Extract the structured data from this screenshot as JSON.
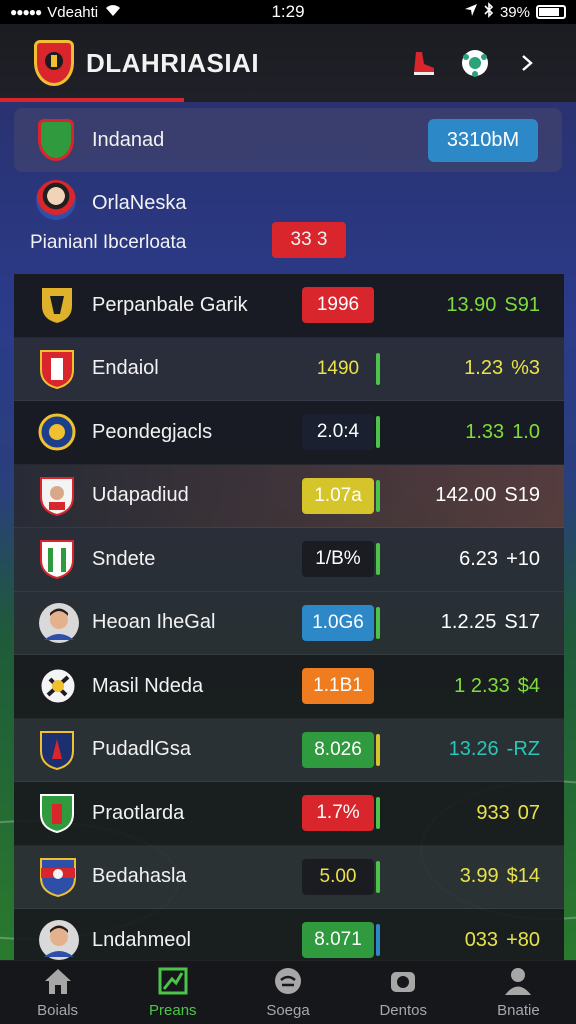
{
  "status_bar": {
    "carrier": "Vdeahti",
    "time": "1:29",
    "battery": "39%"
  },
  "header": {
    "title": "DLAHRIASIAI"
  },
  "top_row": {
    "name": "Indanad",
    "value": "3310bM"
  },
  "group": {
    "name": "OrlaNeska",
    "subtitle": "Pianianl Ibcerloata",
    "value": "33 3"
  },
  "rows": [
    {
      "name": "Perpanbale Garik",
      "odds": "1996",
      "odds_bg": "#d9252c",
      "odds_color": "#ffffff",
      "bar": "",
      "right_a": "13.90",
      "right_b": "S91",
      "right_color": "#7fdc3a",
      "style": "dark",
      "icon": "crest-yellow-icon"
    },
    {
      "name": "Endaiol",
      "odds": "1490",
      "odds_bg": "transparent",
      "odds_color": "#e8e24a",
      "bar": "#4cc44a",
      "right_a": "1.23",
      "right_b": "%3",
      "right_color": "#e8e24a",
      "style": "mid",
      "icon": "crest-red-icon"
    },
    {
      "name": "Peondegjacls",
      "odds": "2.0:4",
      "odds_bg": "#1b2030",
      "odds_color": "#ffffff",
      "bar": "#4cc44a",
      "right_a": "1.33",
      "right_b": "1.0",
      "right_color": "#7fdc3a",
      "style": "dark",
      "icon": "crest-blue-yellow-icon"
    },
    {
      "name": "Udapadiud",
      "odds": "1.07a",
      "odds_bg": "#d6c52a",
      "odds_color": "#ffffff",
      "bar": "#4cc44a",
      "right_a": "142.00",
      "right_b": "S19",
      "right_color": "#ffffff",
      "style": "hl",
      "icon": "avatar-icon"
    },
    {
      "name": "Sndete",
      "odds": "1/B%",
      "odds_bg": "#1b1c22",
      "odds_color": "#ffffff",
      "bar": "#4cc44a",
      "right_a": "6.23",
      "right_b": "+10",
      "right_color": "#ffffff",
      "style": "mid",
      "icon": "crest-green-icon"
    },
    {
      "name": "Heoan IheGal",
      "odds": "1.0G6",
      "odds_bg": "#2d88c8",
      "odds_color": "#ffffff",
      "bar": "#4cc44a",
      "right_a": "1.2.25",
      "right_b": "S17",
      "right_color": "#ffffff",
      "style": "mid",
      "icon": "player-photo-icon"
    },
    {
      "name": "Masil Ndeda",
      "odds": "1.1B1",
      "odds_bg": "#ef7d20",
      "odds_color": "#ffffff",
      "bar": "",
      "right_a": "1 2.33",
      "right_b": "$4",
      "right_color": "#7fdc3a",
      "style": "dark",
      "icon": "crest-black-icon"
    },
    {
      "name": "PudadlGsa",
      "odds": "8.026",
      "odds_bg": "#2f9a3e",
      "odds_color": "#ffffff",
      "bar": "#d6c52a",
      "right_a": "13.26",
      "right_b": "-RZ",
      "right_color": "#29c7b5",
      "style": "mid",
      "icon": "crest-navy-icon"
    },
    {
      "name": "Praotlarda",
      "odds": "1.7%",
      "odds_bg": "#d9252c",
      "odds_color": "#ffffff",
      "bar": "#4cc44a",
      "right_a": "933",
      "right_b": "07",
      "right_color": "#e8e24a",
      "style": "dark",
      "icon": "crest-green-red-icon"
    },
    {
      "name": "Bedahasla",
      "odds": "5.00",
      "odds_bg": "#1b1c22",
      "odds_color": "#e8e24a",
      "bar": "#4cc44a",
      "right_a": "3.99",
      "right_b": "$14",
      "right_color": "#e8e24a",
      "style": "mid",
      "icon": "crest-red-blue-icon"
    },
    {
      "name": "Lndahmeol",
      "odds": "8.071",
      "odds_bg": "#2f9a3e",
      "odds_color": "#ffffff",
      "bar": "#2d88c8",
      "right_a": "033",
      "right_b": "+80",
      "right_color": "#e8e24a",
      "style": "dark",
      "icon": "player-photo-icon"
    }
  ],
  "tabs": [
    {
      "label": "Boials",
      "icon": "home-icon",
      "active": false
    },
    {
      "label": "Preans",
      "icon": "pitch-icon",
      "active": true
    },
    {
      "label": "Soega",
      "icon": "ball-icon",
      "active": false
    },
    {
      "label": "Dentos",
      "icon": "camera-icon",
      "active": false
    },
    {
      "label": "Bnatie",
      "icon": "profile-icon",
      "active": false
    }
  ]
}
